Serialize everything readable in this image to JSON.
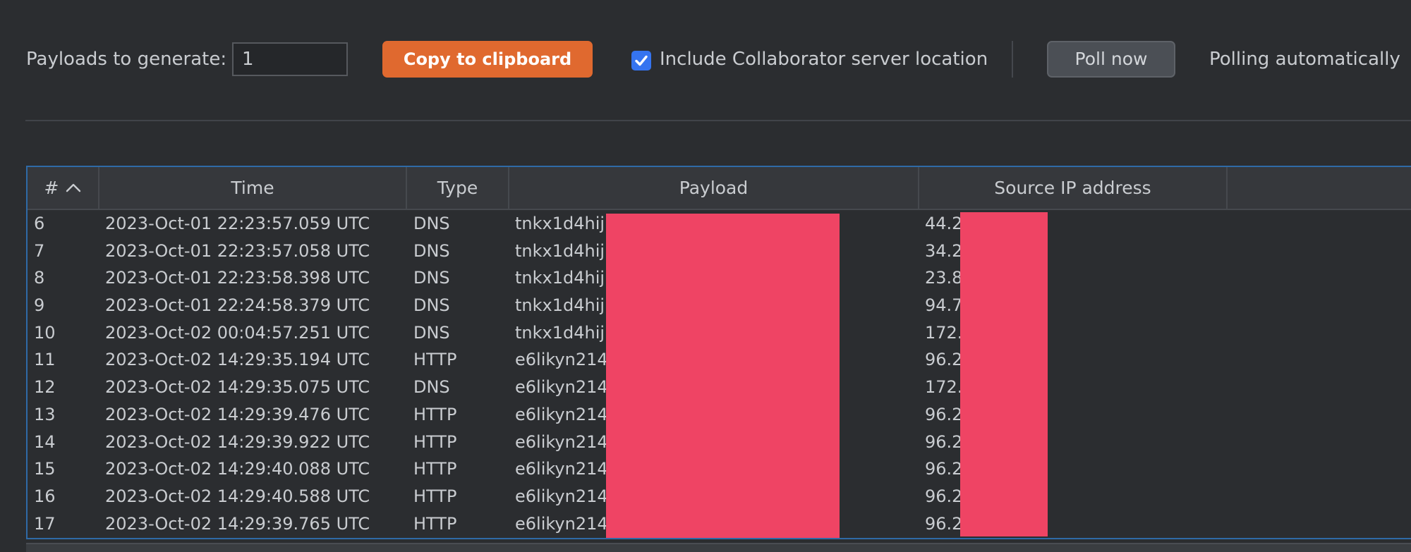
{
  "toolbar": {
    "payloads_label": "Payloads to generate:",
    "payloads_value": "1",
    "copy_button": "Copy to clipboard",
    "include_location_label": "Include Collaborator server location",
    "include_location_checked": true,
    "poll_button": "Poll now",
    "polling_status": "Polling automatically"
  },
  "table": {
    "columns": [
      "#",
      "Time",
      "Type",
      "Payload",
      "Source IP address"
    ],
    "sort_icon": "chevron-up-icon",
    "rows": [
      {
        "num": "6",
        "time": "2023-Oct-01 22:23:57.059 UTC",
        "type": "DNS",
        "payload": "tnkx1d4hij",
        "ip": "44.2"
      },
      {
        "num": "7",
        "time": "2023-Oct-01 22:23:57.058 UTC",
        "type": "DNS",
        "payload": "tnkx1d4hij",
        "ip": "34.2"
      },
      {
        "num": "8",
        "time": "2023-Oct-01 22:23:58.398 UTC",
        "type": "DNS",
        "payload": "tnkx1d4hij",
        "ip": "23.8"
      },
      {
        "num": "9",
        "time": "2023-Oct-01 22:24:58.379 UTC",
        "type": "DNS",
        "payload": "tnkx1d4hij",
        "ip": "94.7"
      },
      {
        "num": "10",
        "time": "2023-Oct-02 00:04:57.251 UTC",
        "type": "DNS",
        "payload": "tnkx1d4hij",
        "ip": "172."
      },
      {
        "num": "11",
        "time": "2023-Oct-02 14:29:35.194 UTC",
        "type": "HTTP",
        "payload": "e6likyn214",
        "ip": "96.2"
      },
      {
        "num": "12",
        "time": "2023-Oct-02 14:29:35.075 UTC",
        "type": "DNS",
        "payload": "e6likyn214",
        "ip": "172."
      },
      {
        "num": "13",
        "time": "2023-Oct-02 14:29:39.476 UTC",
        "type": "HTTP",
        "payload": "e6likyn214",
        "ip": "96.2"
      },
      {
        "num": "14",
        "time": "2023-Oct-02 14:29:39.922 UTC",
        "type": "HTTP",
        "payload": "e6likyn214",
        "ip": "96.2"
      },
      {
        "num": "15",
        "time": "2023-Oct-02 14:29:40.088 UTC",
        "type": "HTTP",
        "payload": "e6likyn214",
        "ip": "96.2"
      },
      {
        "num": "16",
        "time": "2023-Oct-02 14:29:40.588 UTC",
        "type": "HTTP",
        "payload": "e6likyn214",
        "ip": "96.2"
      },
      {
        "num": "17",
        "time": "2023-Oct-02 14:29:39.765 UTC",
        "type": "HTTP",
        "payload": "e6likyn214",
        "ip": "96.2"
      }
    ]
  },
  "colors": {
    "background": "#2b2d30",
    "copy_button": "#e0692f",
    "checkbox": "#3574f0",
    "table_focus_border": "#2f6aa6",
    "redaction": "#ef4464"
  }
}
